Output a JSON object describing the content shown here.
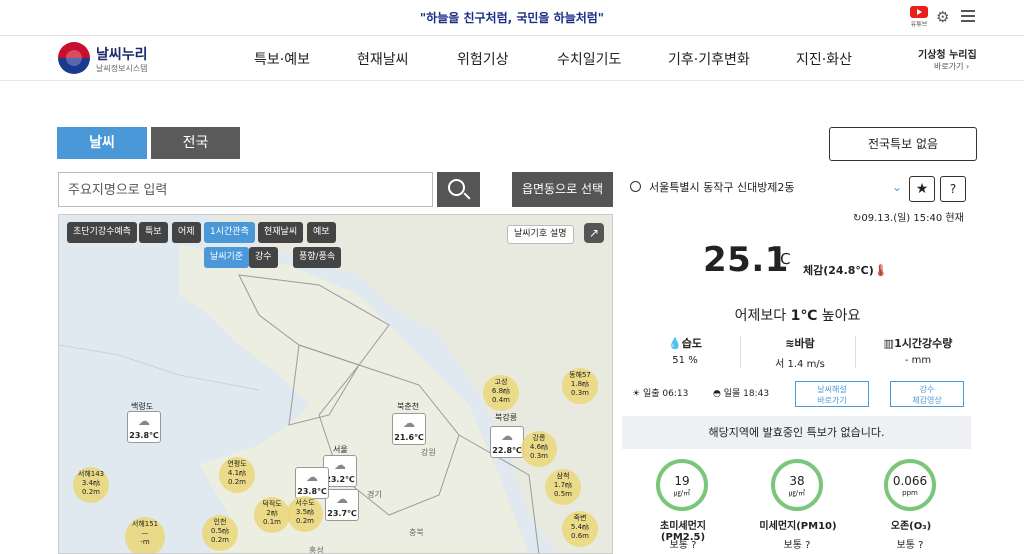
{
  "top": {
    "slogan": "\"하늘을 친구처럼, 국민을 하늘처럼\"",
    "youtube_label": "유튜브"
  },
  "nav": {
    "logo_title": "날씨누리",
    "logo_sub": "날씨정보시스템",
    "items": [
      "특보·예보",
      "현재날씨",
      "위험기상",
      "수치일기도",
      "기후·기후변화",
      "지진·화산"
    ],
    "portal_title": "기상청 누리집",
    "portal_sub": "바로가기 ›"
  },
  "tabs": {
    "weather": "날씨",
    "national": "전국"
  },
  "search": {
    "placeholder": "주요지명으로 입력",
    "umd_button": "읍면동으로 선택"
  },
  "map": {
    "buttons": [
      "초단기강수예측",
      "특보",
      "어제",
      "1시간관측",
      "현재날씨",
      "예보"
    ],
    "buttons2": [
      "날씨기준",
      "강수",
      "풍향/풍속"
    ],
    "legend": "날씨기호 설명",
    "stations": [
      {
        "name": "백령도",
        "temp": "23.8℃"
      },
      {
        "name": "북춘천",
        "temp": "21.6℃"
      },
      {
        "name": "북강릉",
        "temp": "22.8℃"
      },
      {
        "name": "서울",
        "temp": "23.2℃"
      },
      {
        "name": "",
        "temp": "23.7℃"
      },
      {
        "name": "",
        "temp": "23.8℃"
      }
    ],
    "winds": [
      {
        "name": "서해143",
        "v1": "3.4㎧",
        "v2": "0.2m"
      },
      {
        "name": "서해151",
        "v1": "",
        "v2": ""
      },
      {
        "name": "연평도",
        "v1": "4.1㎧",
        "v2": "0.2m"
      },
      {
        "name": "덕적도",
        "v1": "2㎧",
        "v2": "0.1m"
      },
      {
        "name": "서수도",
        "v1": "3.5㎧",
        "v2": "0.2m"
      },
      {
        "name": "인천",
        "v1": "0.5㎧",
        "v2": "0.2m"
      },
      {
        "name": "고성",
        "v1": "6.8㎧",
        "v2": "0.4m"
      },
      {
        "name": "동해57",
        "v1": "1.8㎧",
        "v2": "0.3m"
      },
      {
        "name": "강릉",
        "v1": "4.6㎧",
        "v2": "0.3m"
      },
      {
        "name": "삼척",
        "v1": "1.7㎧",
        "v2": "0.5m"
      },
      {
        "name": "죽변",
        "v1": "5.4㎧",
        "v2": "0.6m"
      }
    ],
    "places": [
      "강원",
      "경기",
      "충북",
      "홍성"
    ]
  },
  "right": {
    "notice_button": "전국특보 없음",
    "location": "서울특별시 동작구 신대방제2동",
    "update": "09.13.(일) 15:40 현재",
    "temp": "25.1",
    "unit": "℃",
    "feels": "체감(24.8℃)",
    "compare_pre": "어제보다 ",
    "compare_val": "1℃",
    "compare_post": " 높아요",
    "stats": [
      {
        "label": "습도",
        "value": "51 %"
      },
      {
        "label": "바람",
        "value": "서 1.4 m/s"
      },
      {
        "label": "1시간강수량",
        "value": "- mm"
      }
    ],
    "sunrise_label": "일출",
    "sunrise": "06:13",
    "sunset_label": "일몰",
    "sunset": "18:43",
    "btn_sat": "날씨해설\n바로가기",
    "btn_rain": "강수\n체감영상",
    "nowarn": "해당지역에 발효중인 특보가 없습니다.",
    "dust": [
      {
        "value": "19",
        "unit": "㎍/㎥",
        "name": "초미세먼지(PM2.5)",
        "state": "보통"
      },
      {
        "value": "38",
        "unit": "㎍/㎥",
        "name": "미세먼지(PM10)",
        "state": "보통"
      },
      {
        "value": "0.066",
        "unit": "ppm",
        "name": "오존(O₃)",
        "state": "보통"
      }
    ]
  },
  "colors": {
    "accent": "#4b98d8",
    "dark_tab": "#5a5a5a",
    "gauge": "#7bc67a"
  }
}
